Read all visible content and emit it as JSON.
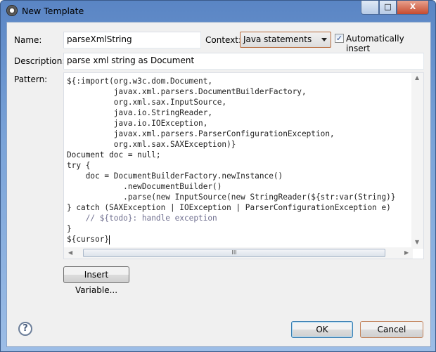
{
  "window": {
    "title": "New Template",
    "minimize_label": "▭",
    "maximize_label": "□",
    "close_label": "X"
  },
  "form": {
    "name_label": "Name:",
    "name_value": "parseXmlString",
    "context_label": "Context:",
    "context_value": "Java statements",
    "auto_insert_label": "Automatically insert",
    "auto_insert_checked": true,
    "description_label": "Description:",
    "description_value": "parse xml string as Document",
    "pattern_label": "Pattern:",
    "pattern_lines": [
      "${:import(org.w3c.dom.Document,",
      "          javax.xml.parsers.DocumentBuilderFactory,",
      "          org.xml.sax.InputSource,",
      "          java.io.StringReader,",
      "          java.io.IOException,",
      "          javax.xml.parsers.ParserConfigurationException,",
      "          org.xml.sax.SAXException)}",
      "Document doc = null;",
      "try {",
      "    doc = DocumentBuilderFactory.newInstance()",
      "            .newDocumentBuilder()",
      "            .parse(new InputSource(new StringReader(${str:var(String)}",
      "} catch (SAXException | IOException | ParserConfigurationException e)",
      "    // ${todo}: handle exception",
      "}",
      "${cursor}"
    ],
    "insert_variable_label": "Insert Variable..."
  },
  "footer": {
    "help_label": "?",
    "ok_label": "OK",
    "cancel_label": "Cancel"
  },
  "scroll": {
    "thumb_grip": "III"
  }
}
